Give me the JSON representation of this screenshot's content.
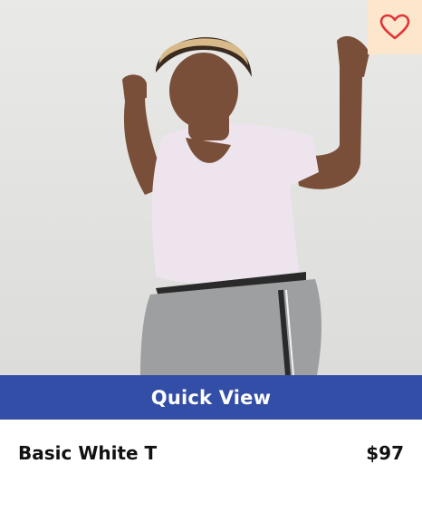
{
  "product": {
    "image_icon": "person-dancing-photo",
    "favorite_icon": "heart-outline-icon",
    "quick_view_label": "Quick View",
    "name": "Basic White T",
    "price": "$97"
  },
  "colors": {
    "accent": "#334ea6",
    "favorite_bg": "#fde7cc",
    "favorite_icon": "#e0363a",
    "text": "#111111"
  }
}
